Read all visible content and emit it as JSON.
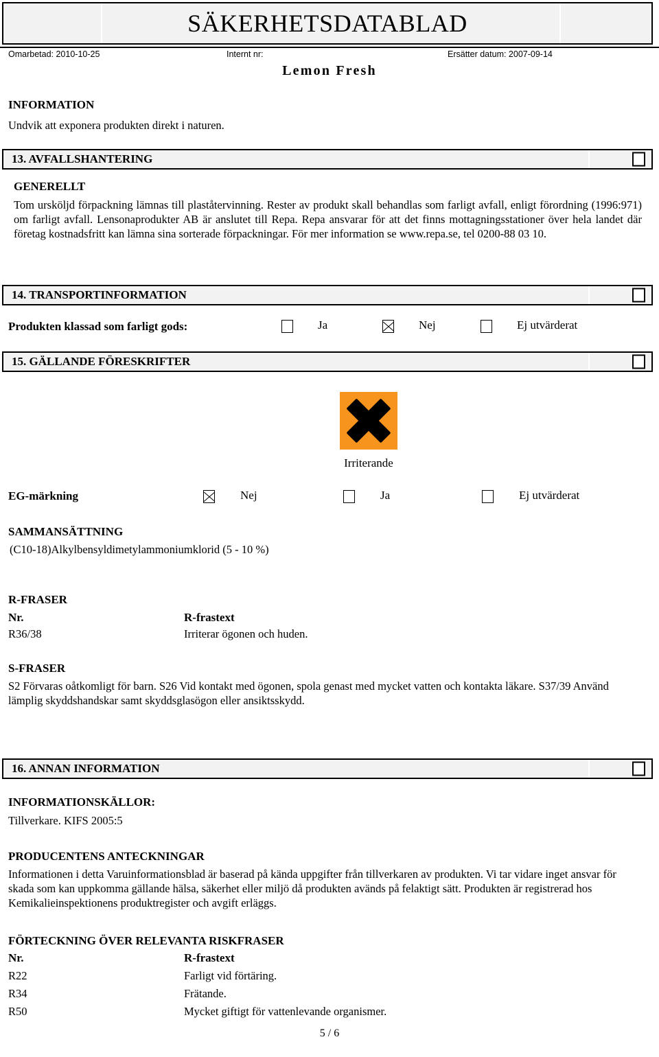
{
  "header": {
    "doc_title": "SÄKERHETSDATABLAD",
    "revised_label": "Omarbetad: 2010-10-25",
    "internal_no_label": "Internt nr:",
    "replaces_label": "Ersätter datum: 2007-09-14",
    "product_name": "Lemon Fresh"
  },
  "information": {
    "heading": "INFORMATION",
    "text": "Undvik att exponera produkten direkt i naturen."
  },
  "section13": {
    "title": "13. AVFALLSHANTERING",
    "subheading": "GENERELLT",
    "paragraph": "Tom ursköljd förpackning lämnas till plaståtervinning. Rester av produkt skall behandlas som farligt avfall, enligt förordning (1996:971) om farligt avfall. Lensonaprodukter AB är anslutet till Repa. Repa ansvarar för att det finns mottagningsstationer över hela landet där företag kostnadsfritt kan lämna sina sorterade förpackningar. För mer information se www.repa.se, tel 0200-88 03 10."
  },
  "section14": {
    "title": "14. TRANSPORTINFORMATION",
    "question": "Produkten klassad som farligt gods:",
    "options": [
      {
        "label": "Ja",
        "checked": false
      },
      {
        "label": "Nej",
        "checked": true
      },
      {
        "label": "Ej utvärderat",
        "checked": false
      }
    ]
  },
  "section15": {
    "title": "15. GÄLLANDE FÖRESKRIFTER",
    "pictogram": {
      "icon": "irritant-x-icon",
      "caption": "Irriterande",
      "background_color": "#F7941E",
      "symbol_color": "#000000"
    },
    "eg_label": "EG-märkning",
    "eg_options": [
      {
        "label": "Nej",
        "checked": true
      },
      {
        "label": "Ja",
        "checked": false
      },
      {
        "label": "Ej utvärderat",
        "checked": false
      }
    ],
    "composition_heading": "SAMMANSÄTTNING",
    "composition_text": "(C10-18)Alkylbensyldimetylammoniumklorid (5 - 10 %)",
    "r_phrases_heading": "R-FRASER",
    "r_col_nr": "Nr.",
    "r_col_text": "R-frastext",
    "r_phrases": [
      {
        "nr": "R36/38",
        "text": "Irriterar ögonen och huden."
      }
    ],
    "s_phrases_heading": "S-FRASER",
    "s_phrases_text": "S2 Förvaras oåtkomligt för barn. S26 Vid kontakt med ögonen, spola genast med mycket vatten och kontakta läkare. S37/39 Använd lämplig skyddshandskar samt skyddsglasögon eller ansiktsskydd."
  },
  "section16": {
    "title": "16. ANNAN INFORMATION",
    "sources_heading": "INFORMATIONSKÄLLOR:",
    "sources_text": "Tillverkare. KIFS 2005:5",
    "producer_notes_heading": "PRODUCENTENS ANTECKNINGAR",
    "producer_notes_text": "Informationen i detta Varuinformationsblad är baserad på kända uppgifter från tillverkaren av produkten. Vi tar vidare inget ansvar för skada som kan uppkomma gällande hälsa, säkerhet eller miljö då produkten avänds på felaktigt sätt. Produkten är registrerad hos Kemikalieinspektionens produktregister och avgift erläggs.",
    "risk_list_heading": "FÖRTECKNING ÖVER RELEVANTA RISKFRASER",
    "risk_col_nr": "Nr.",
    "risk_col_text": "R-frastext",
    "risk_phrases": [
      {
        "nr": "R22",
        "text": "Farligt vid förtäring."
      },
      {
        "nr": "R34",
        "text": "Frätande."
      },
      {
        "nr": "R50",
        "text": "Mycket giftigt för vattenlevande organismer."
      }
    ]
  },
  "footer": {
    "page": "5 / 6"
  }
}
